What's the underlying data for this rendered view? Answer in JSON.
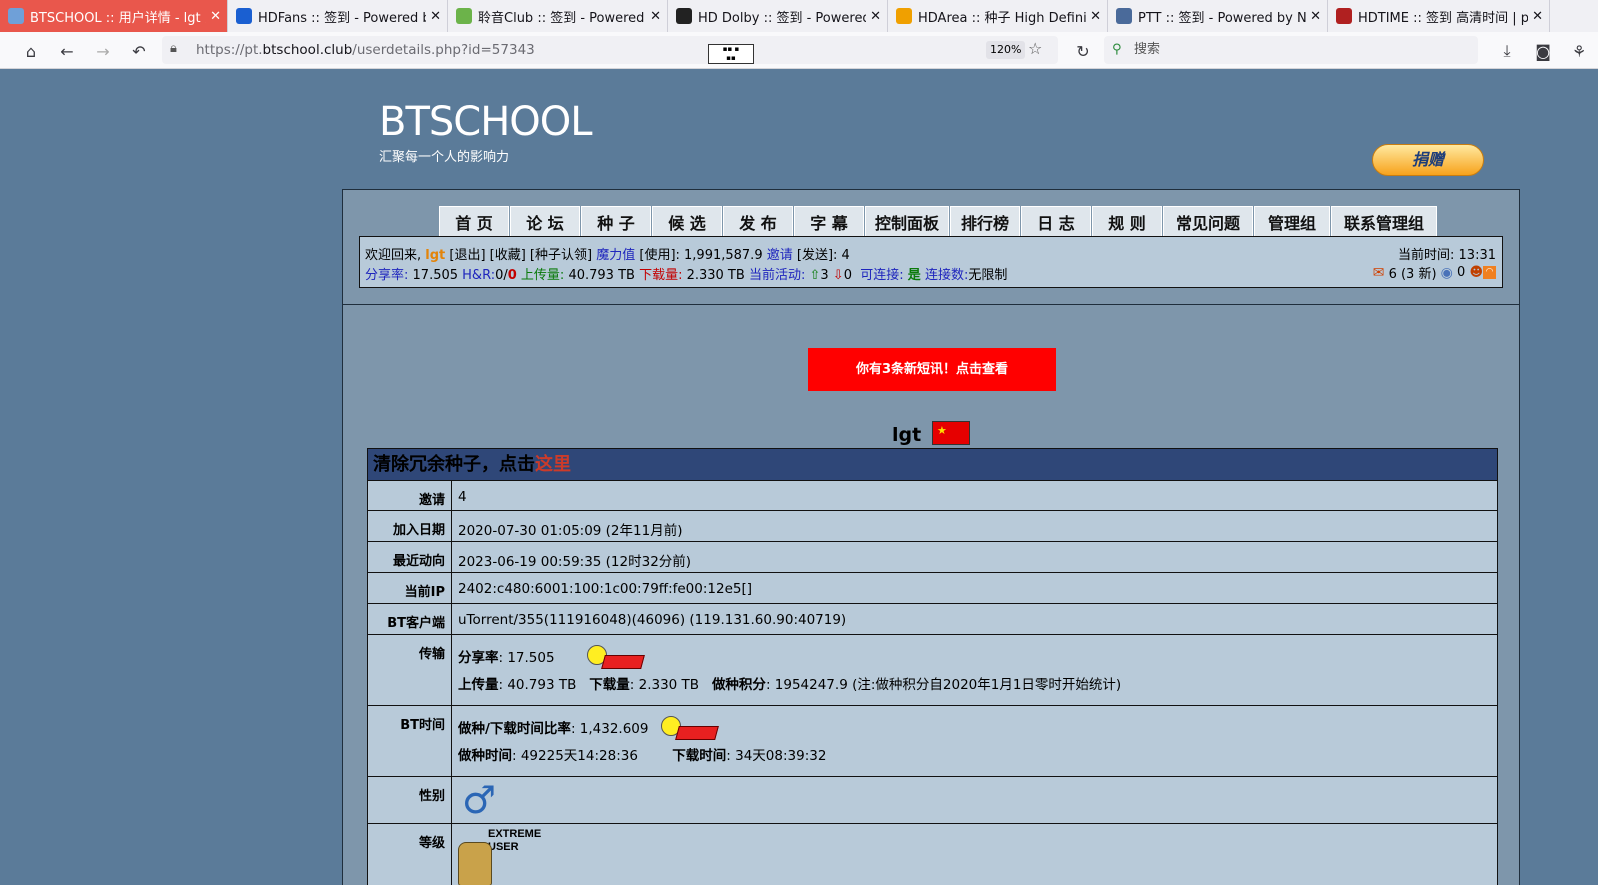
{
  "browser": {
    "tabs": [
      {
        "title": "BTSCHOOL :: 用户详情 - lgt 比特",
        "icon": "btschool-icon",
        "color": "#6fa0d8",
        "active": true
      },
      {
        "title": "HDFans :: 签到 - Powered by N",
        "icon": "hdfans-icon",
        "color": "#1a5fd1"
      },
      {
        "title": "聆音Club :: 签到 - Powered by N",
        "icon": "leaf-icon",
        "color": "#6cb34a"
      },
      {
        "title": "HD Dolby :: 签到 - Powered by",
        "icon": "dolby-icon",
        "color": "#222222"
      },
      {
        "title": "HDArea :: 种子 High Definition",
        "icon": "hdarea-icon",
        "color": "#f0a000"
      },
      {
        "title": "PTT :: 签到 - Powered by Nexus",
        "icon": "ptt-icon",
        "color": "#4a6a9a"
      },
      {
        "title": "HDTIME :: 签到 高清时间 | pt",
        "icon": "hdtime-icon",
        "color": "#b02020"
      }
    ],
    "url_prefix": "https://pt.",
    "url_domain": "btschool.club",
    "url_path": "/userdetails.php?id=57343",
    "zoom": "120%",
    "search_placeholder": "搜索"
  },
  "site": {
    "title": "BTSCHOOL",
    "slogan": "汇聚每一个人的影响力",
    "donate": "捐赠",
    "menu": [
      {
        "label": "首 页",
        "w": 70
      },
      {
        "label": "论 坛",
        "w": 70
      },
      {
        "label": "种 子",
        "w": 70
      },
      {
        "label": "候 选",
        "w": 70
      },
      {
        "label": "发 布",
        "w": 70
      },
      {
        "label": "字 幕",
        "w": 70
      },
      {
        "label": "控制面板",
        "w": 84
      },
      {
        "label": "排行榜",
        "w": 70
      },
      {
        "label": "日 志",
        "w": 70
      },
      {
        "label": "规 则",
        "w": 70
      },
      {
        "label": "常见问题",
        "w": 90
      },
      {
        "label": "管理组",
        "w": 76
      },
      {
        "label": "联系管理组",
        "w": 106
      }
    ],
    "info": {
      "welcome": "欢迎回来, ",
      "username": "lgt",
      "logout": " [退出] [收藏] [种子认领] ",
      "bonus_label": "魔力值",
      "bonus_text": " [使用]: 1,991,587.9 ",
      "invite_label": "邀请",
      "invite_text": " [发送]: 4",
      "ratio_label": "分享率:",
      "ratio": " 17.505 ",
      "hr_label": "H&R:",
      "hr_value": "0/",
      "hr_red": "0",
      "up_label": " 上传量:",
      "up": " 40.793 TB ",
      "down_label": "下载量:",
      "down": " 2.330 TB ",
      "active_label": "当前活动:",
      "seeding": "3",
      "leeching": "0",
      "connectable_label": "可连接:",
      "connectable": "是",
      "conn_label": "连接数:",
      "conn": "无限制",
      "time_label": "当前时间:",
      "time": "13:31",
      "msgs": "6 (3 新)",
      "friends": "0"
    },
    "alert": "你有3条新短讯！点击查看",
    "profile": {
      "username": "lgt",
      "banner_text": "清除冗余种子，点击",
      "banner_link": "这里",
      "rows": [
        {
          "key": "邀请",
          "value": "4"
        },
        {
          "key": "加入日期",
          "value": "2020-07-30 01:05:09 (2年11月前)"
        },
        {
          "key": "最近动向",
          "value": "2023-06-19 00:59:35 (12时32分前)"
        },
        {
          "key": "当前IP",
          "value": "2402:c480:6001:100:1c00:79ff:fe00:12e5[]"
        },
        {
          "key": "BT客户端",
          "value": "uTorrent/355(111916048)(46096) (119.131.60.90:40719)"
        }
      ],
      "transfer": {
        "key": "传输",
        "ratio_label": "分享率",
        "ratio": ": 17.505",
        "up_label": "上传量",
        "up": ": 40.793 TB",
        "down_label": "下载量",
        "down": ": 2.330 TB",
        "seed_label": "做种积分",
        "seed": ": 1954247.9 (注:做种积分自2020年1月1日零时开始统计)"
      },
      "bttime": {
        "key": "BT时间",
        "ratio_label": "做种/下载时间比率",
        "ratio": ": 1,432.609",
        "seed_label": "做种时间",
        "seed": ": 49225天14:28:36",
        "down_label": "下载时间",
        "down": ": 34天08:39:32"
      },
      "gender": {
        "key": "性别",
        "symbol": "♂"
      },
      "level": {
        "key": "等级",
        "line1": "EXTREME",
        "line2": "USER"
      }
    }
  }
}
